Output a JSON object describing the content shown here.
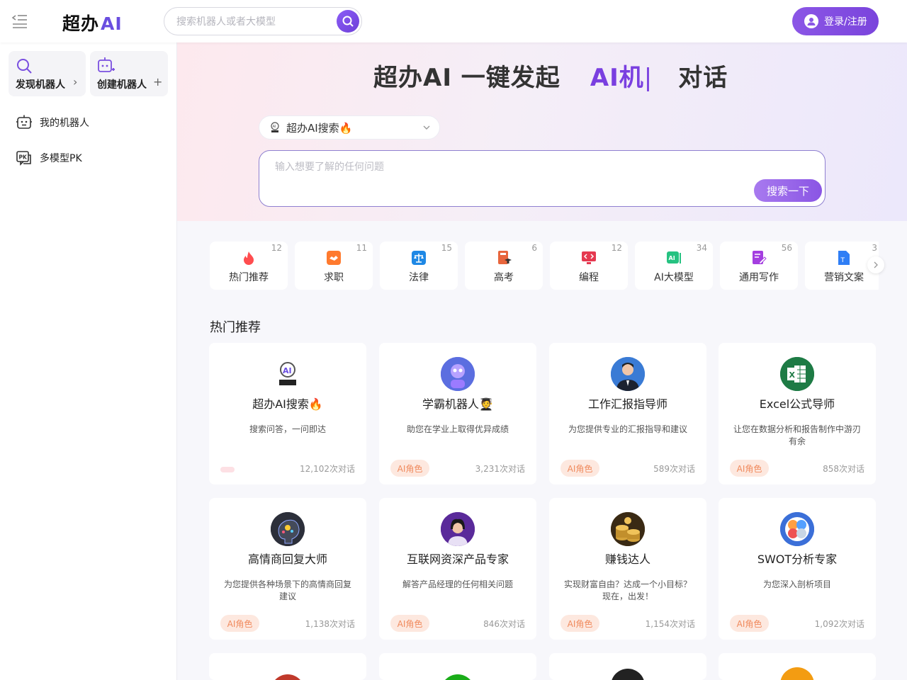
{
  "brand": {
    "name": "超办",
    "ai": "AI"
  },
  "header": {
    "search_placeholder": "搜索机器人或者大模型",
    "login_label": "登录/注册"
  },
  "sidebar": {
    "discover_label": "发现机器人",
    "create_label": "创建机器人",
    "items": [
      {
        "label": "我的机器人",
        "icon": "robot-icon"
      },
      {
        "label": "多模型PK",
        "icon": "pk-icon"
      }
    ]
  },
  "hero": {
    "title_main": "超办AI 一键发起",
    "title_highlight": "AI机",
    "title_caret": "|",
    "title_rest": "对话",
    "model_selected": "超办AI搜索🔥",
    "ask_placeholder": "输入想要了解的任何问题",
    "ask_button": "搜索一下"
  },
  "categories": [
    {
      "label": "热门推荐",
      "count": "12",
      "color": "#ff4d4f"
    },
    {
      "label": "求职",
      "count": "11",
      "color": "#ff7a2e"
    },
    {
      "label": "法律",
      "count": "15",
      "color": "#1e88e5"
    },
    {
      "label": "高考",
      "count": "6",
      "color": "#e8663d"
    },
    {
      "label": "编程",
      "count": "12",
      "color": "#e53950"
    },
    {
      "label": "AI大模型",
      "count": "34",
      "color": "#26c281"
    },
    {
      "label": "通用写作",
      "count": "56",
      "color": "#a43ee0"
    },
    {
      "label": "营销文案",
      "count": "3",
      "color": "#2f7ef5"
    }
  ],
  "section_title": "热门推荐",
  "bots": [
    {
      "name": "超办AI搜索🔥",
      "desc": "搜索问答，一问即达",
      "tag": "",
      "stat": "12,102次对话",
      "avatar_color": "#ffffff",
      "avatar_icon": "chaoban-logo-icon"
    },
    {
      "name": "学霸机器人🧑‍🎓",
      "desc": "助您在学业上取得优异成绩",
      "tag": "AI角色",
      "stat": "3,231次对话",
      "avatar_color": "#5b6ee0",
      "avatar_icon": "robot-avatar-icon"
    },
    {
      "name": "工作汇报指导师",
      "desc": "为您提供专业的汇报指导和建议",
      "tag": "AI角色",
      "stat": "589次对话",
      "avatar_color": "#3a7bd5",
      "avatar_icon": "person-avatar-icon"
    },
    {
      "name": "Excel公式导师",
      "desc": "让您在数据分析和报告制作中游刃有余",
      "tag": "AI角色",
      "stat": "858次对话",
      "avatar_color": "#1e7b45",
      "avatar_icon": "excel-icon"
    },
    {
      "name": "高情商回复大师",
      "desc": "为您提供各种场景下的高情商回复建议",
      "tag": "AI角色",
      "stat": "1,138次对话",
      "avatar_color": "#2c2f3a",
      "avatar_icon": "brain-avatar-icon"
    },
    {
      "name": "互联网资深产品专家",
      "desc": "解答产品经理的任何相关问题",
      "tag": "AI角色",
      "stat": "846次对话",
      "avatar_color": "#5a2a9a",
      "avatar_icon": "person-avatar-icon"
    },
    {
      "name": "赚钱达人",
      "desc": "实现财富自由？达成一个小目标？现在，出发！",
      "tag": "AI角色",
      "stat": "1,154次对话",
      "avatar_color": "#6b4a1f",
      "avatar_icon": "coins-avatar-icon"
    },
    {
      "name": "SWOT分析专家",
      "desc": "为您深入剖析项目",
      "tag": "AI角色",
      "stat": "1,092次对话",
      "avatar_color": "#3b6fd8",
      "avatar_icon": "swot-avatar-icon"
    }
  ],
  "partial_bots": [
    {
      "avatar_color": "#c0392b"
    },
    {
      "avatar_color": "#1aad19"
    },
    {
      "avatar_color": "#222222"
    },
    {
      "avatar_color": "#f39c12"
    }
  ]
}
